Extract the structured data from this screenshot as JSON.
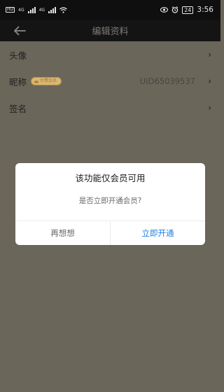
{
  "status_bar": {
    "network_tag_1": "HD",
    "network_tag_2": "HD",
    "signal_1_label": "4G",
    "signal_2_label": "4G",
    "battery": "24",
    "time": "3:56",
    "icons": [
      "eye-icon",
      "alarm-icon",
      "wifi-icon",
      "signal-icon"
    ]
  },
  "nav": {
    "title": "编辑资料",
    "back_icon": "arrow-left-icon"
  },
  "list": {
    "avatar_label": "头像",
    "nickname_label": "昵称",
    "vip_badge": "付费会员",
    "uid": "UID65039537",
    "signature_label": "签名",
    "chevron": "›"
  },
  "dialog": {
    "title": "该功能仅会员可用",
    "message": "是否立即开通会员?",
    "cancel_label": "再想想",
    "confirm_label": "立即开通"
  },
  "colors": {
    "overlay": "#6b665a",
    "accent": "#1f7fe0",
    "vip": "#d7b77a"
  }
}
